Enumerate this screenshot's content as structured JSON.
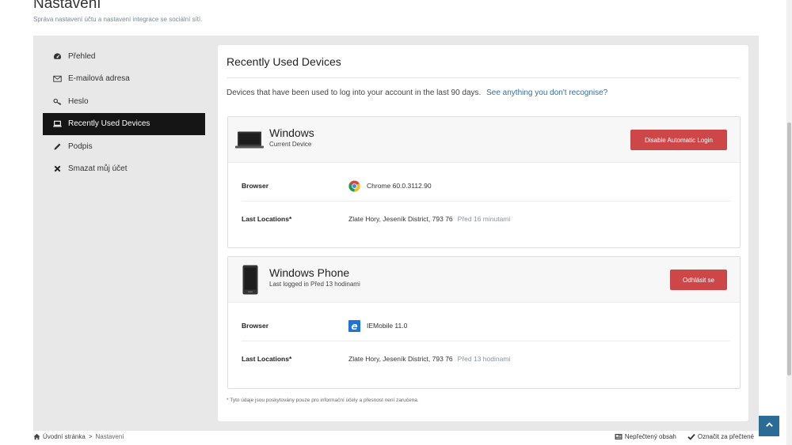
{
  "header": {
    "title": "Nastavení",
    "subtitle": "Správa nastavení účtu a nastavení integrace se sociální sítí."
  },
  "sidebar": {
    "items": [
      {
        "label": "Přehled",
        "icon": "dashboard-icon"
      },
      {
        "label": "E-mailová adresa",
        "icon": "envelope-icon"
      },
      {
        "label": "Heslo",
        "icon": "key-icon"
      },
      {
        "label": "Recently Used Devices",
        "icon": "laptop-icon",
        "active": true
      },
      {
        "label": "Podpis",
        "icon": "pencil-icon"
      },
      {
        "label": "Smazat můj účet",
        "icon": "close-icon"
      }
    ]
  },
  "main": {
    "title": "Recently Used Devices",
    "intro": "Devices that have been used to log into your account in the last 90 days.",
    "intro_link": "See anything you don't recognise?",
    "devices": [
      {
        "name": "Windows",
        "subtitle": "Current Device",
        "button": "Disable Automatic Login",
        "browser_label": "Browser",
        "browser_value": "Chrome 60.0.3112.90",
        "browser_icon": "chrome-icon",
        "location_label": "Last Locations*",
        "location_value": "Zlate Hory, Jeseník District, 793 76",
        "location_ago": "Před 16 minutami"
      },
      {
        "name": "Windows Phone",
        "subtitle": "Last logged in Před 13 hodinami",
        "button": "Odhlásit se",
        "browser_label": "Browser",
        "browser_value": "IEMobile 11.0",
        "browser_icon": "ie-icon",
        "location_label": "Last Locations*",
        "location_value": "Zlate Hory, Jeseník District, 793 76",
        "location_ago": "Před 13 hodinami"
      }
    ],
    "footnote": "* Tyto údaje jsou poskytovány pouze pro informační účely a přesnost není zaručena."
  },
  "footer": {
    "breadcrumb_home": "Úvodní stránka",
    "breadcrumb_sep": ">",
    "breadcrumb_current": "Nastavení",
    "unread": "Nepřečtený obsah",
    "mark_read": "Označit za přečtené"
  },
  "colors": {
    "accent_red": "#cd4648",
    "link_blue": "#2f6ea5",
    "active_nav": "#151515",
    "scroll_top": "#2c6b95"
  }
}
